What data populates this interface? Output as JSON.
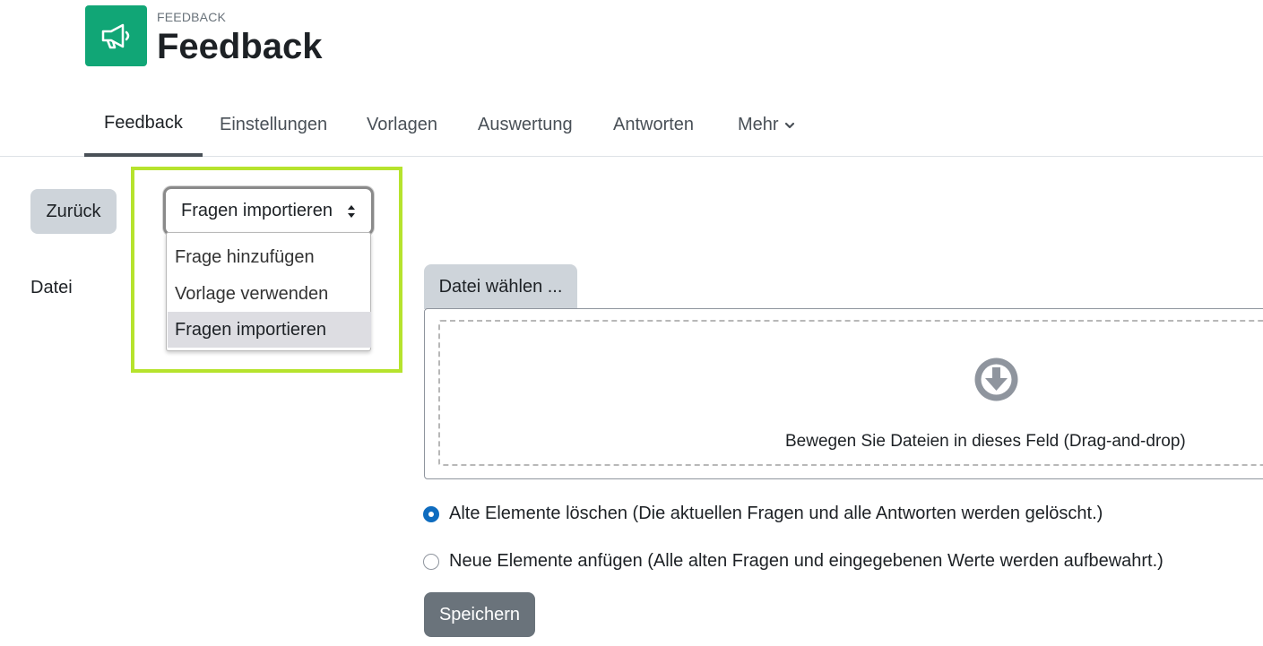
{
  "module": {
    "kicker": "FEEDBACK",
    "title": "Feedback",
    "icon": "megaphone-icon",
    "icon_color": "#11a676"
  },
  "nav": {
    "tabs": [
      {
        "label": "Feedback",
        "active": true
      },
      {
        "label": "Einstellungen",
        "active": false
      },
      {
        "label": "Vorlagen",
        "active": false
      },
      {
        "label": "Auswertung",
        "active": false
      },
      {
        "label": "Antworten",
        "active": false
      },
      {
        "label": "Mehr",
        "active": false
      }
    ]
  },
  "actions": {
    "back_label": "Zurück",
    "select": {
      "value": "Fragen importieren",
      "options": [
        "Frage hinzufügen",
        "Vorlage verwenden",
        "Fragen importieren"
      ],
      "selected_index": 2
    },
    "highlight_color": "#b6e32d"
  },
  "form": {
    "file_label": "Datei",
    "choose_file_label": "Datei wählen ...",
    "drop_text": "Bewegen Sie Dateien in dieses Feld (Drag-and-drop)",
    "options": [
      {
        "label": "Alte Elemente löschen (Die aktuellen Fragen und alle Antworten werden gelöscht.)",
        "checked": true
      },
      {
        "label": "Neue Elemente anfügen (Alle alten Fragen und eingegebenen Werte werden aufbewahrt.)",
        "checked": false
      }
    ],
    "save_label": "Speichern"
  }
}
